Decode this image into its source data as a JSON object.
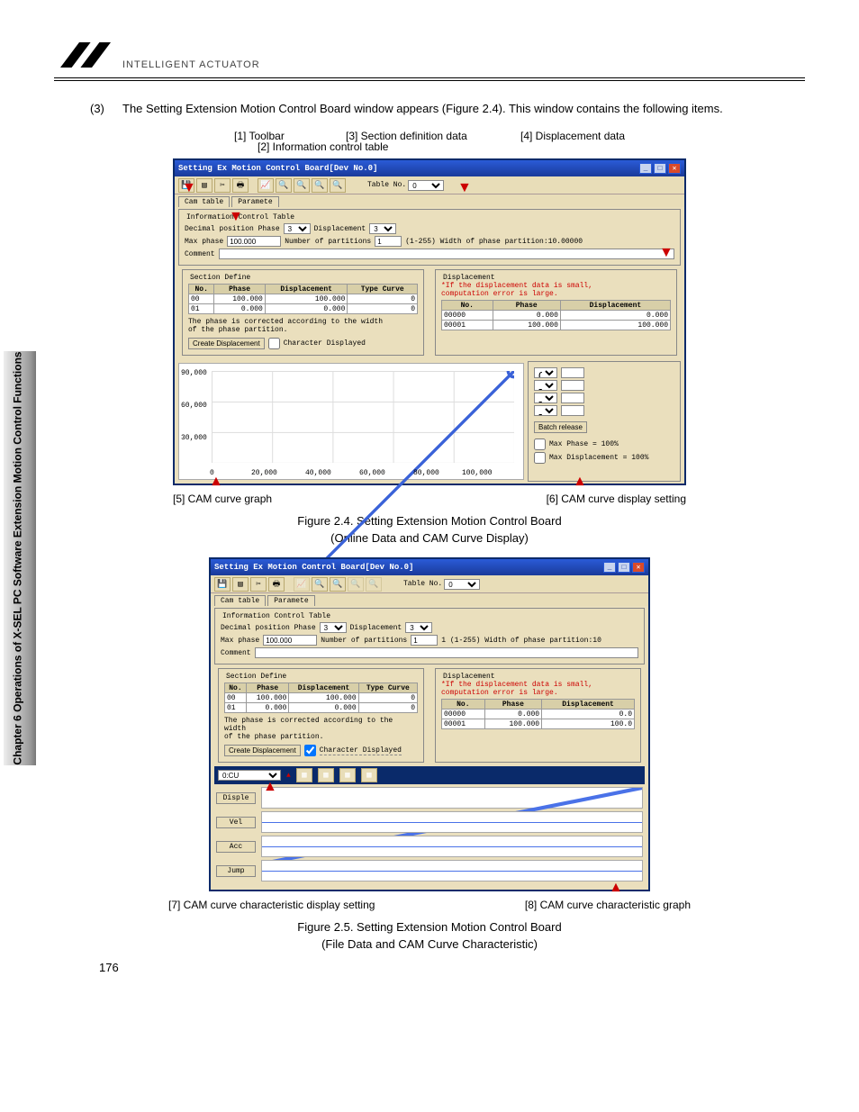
{
  "sidebar_label": "Chapter 6 Operations of X-SEL PC Software Extension Motion Control Functions",
  "logo_text": "INTELLIGENT ACTUATOR",
  "intro": {
    "num": "(3)",
    "text": "The Setting Extension Motion Control Board window appears (Figure 2.4). This window contains the following items."
  },
  "annot": {
    "a1": "[1] Toolbar",
    "a2": "[2] Information control table",
    "a3": "[3] Section definition data",
    "a4": "[4] Displacement data",
    "a5": "[5] CAM curve graph",
    "a6": "[6] CAM curve display setting",
    "a7": "[7] CAM curve characteristic display setting",
    "a8": "[8] CAM curve characteristic graph"
  },
  "fig24": {
    "title": "Setting Ex Motion Control Board[Dev No.0]",
    "toolbar": {
      "table_no_label": "Table No.",
      "table_no": "0"
    },
    "tabs": {
      "cam": "Cam table",
      "param": "Paramete"
    },
    "info": {
      "legend": "Information Control Table",
      "dec_pos": "Decimal position  Phase",
      "dec_pos_v": "3",
      "disp_l": "Displacement",
      "disp_v": "3",
      "max_phase_l": "Max phase",
      "max_phase_v": "100.000",
      "num_part_l": "Number of partitions",
      "num_part_v": "1",
      "range": "(1-255)  Width of phase partition:10.00000",
      "comment_l": "Comment"
    },
    "section": {
      "legend": "Section Define",
      "head": [
        "No.",
        "Phase",
        "Displacement",
        "Type Curve"
      ],
      "rows": [
        [
          "00",
          "100.000",
          "100.000",
          "0"
        ],
        [
          "01",
          "0.000",
          "0.000",
          "0"
        ]
      ],
      "note1": "The phase is corrected according to the width",
      "note2": "of the phase partition.",
      "btn_create": "Create Displacement",
      "chk_char": "Character Displayed"
    },
    "disp": {
      "legend": "Displacement",
      "warn1": "*If the displacement data is small,",
      "warn2": "computation error is large.",
      "head": [
        "No.",
        "Phase",
        "Displacement"
      ],
      "rows": [
        [
          "00000",
          "0.000",
          "0.000"
        ],
        [
          "00001",
          "100.000",
          "100.000"
        ]
      ]
    },
    "rhs": {
      "r0": "0",
      "batch": "Batch release",
      "mp": "Max Phase = 100%",
      "md": "Max Displacement = 100%"
    }
  },
  "fig25": {
    "title": "Setting Ex Motion Control Board[Dev No.0]",
    "toolbar": {
      "table_no_label": "Table No.",
      "table_no": "0"
    },
    "info": {
      "range": "1 (1-255)  Width of phase partition:10"
    },
    "section_rows": [
      [
        "00",
        "100.000",
        "100.000",
        "0"
      ],
      [
        "01",
        "0.000",
        "0.000",
        "0"
      ]
    ],
    "disp_rows": [
      [
        "00000",
        "0.000",
        "0.0"
      ],
      [
        "00001",
        "100.000",
        "100.0"
      ]
    ],
    "strip": {
      "sel": "0:CU"
    },
    "chars": [
      "Disple",
      "Vel",
      "Acc",
      "Jump"
    ]
  },
  "chart_data": {
    "type": "line",
    "title": "",
    "xlabel": "",
    "ylabel": "",
    "x": [
      0,
      20000,
      40000,
      60000,
      80000,
      100000
    ],
    "xticks": [
      "0",
      "20,000",
      "40,000",
      "60,000",
      "80,000",
      "100,000"
    ],
    "yticks": [
      "30,000",
      "60,000",
      "90,000"
    ],
    "ylim": [
      0,
      100000
    ],
    "series": [
      {
        "name": "cam",
        "values": [
          0,
          20000,
          40000,
          60000,
          80000,
          100000
        ]
      }
    ]
  },
  "caption24a": "Figure 2.4. Setting Extension Motion Control Board",
  "caption24b": "(Online Data and CAM Curve Display)",
  "caption25a": "Figure 2.5. Setting Extension Motion Control Board",
  "caption25b": "(File Data and CAM Curve Characteristic)",
  "page_number": "176"
}
